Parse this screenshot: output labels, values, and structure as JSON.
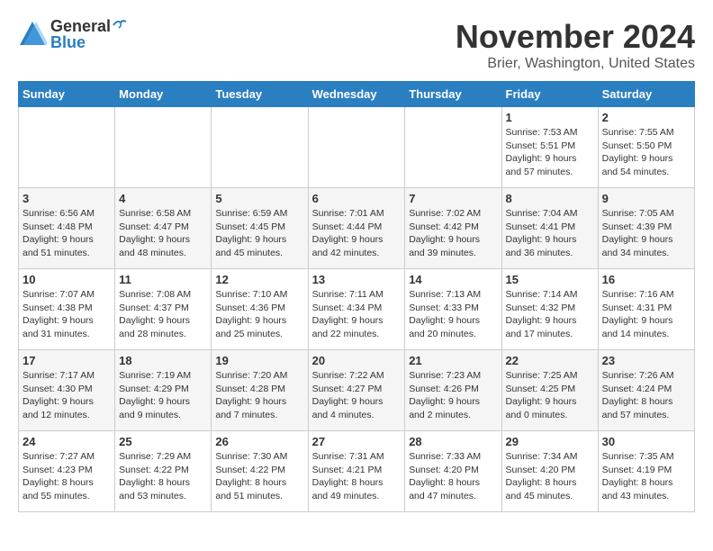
{
  "logo": {
    "general": "General",
    "blue": "Blue"
  },
  "title": "November 2024",
  "location": "Brier, Washington, United States",
  "days_of_week": [
    "Sunday",
    "Monday",
    "Tuesday",
    "Wednesday",
    "Thursday",
    "Friday",
    "Saturday"
  ],
  "weeks": [
    [
      {
        "day": "",
        "sunrise": "",
        "sunset": "",
        "daylight": ""
      },
      {
        "day": "",
        "sunrise": "",
        "sunset": "",
        "daylight": ""
      },
      {
        "day": "",
        "sunrise": "",
        "sunset": "",
        "daylight": ""
      },
      {
        "day": "",
        "sunrise": "",
        "sunset": "",
        "daylight": ""
      },
      {
        "day": "",
        "sunrise": "",
        "sunset": "",
        "daylight": ""
      },
      {
        "day": "1",
        "sunrise": "Sunrise: 7:53 AM",
        "sunset": "Sunset: 5:51 PM",
        "daylight": "Daylight: 9 hours and 57 minutes."
      },
      {
        "day": "2",
        "sunrise": "Sunrise: 7:55 AM",
        "sunset": "Sunset: 5:50 PM",
        "daylight": "Daylight: 9 hours and 54 minutes."
      }
    ],
    [
      {
        "day": "3",
        "sunrise": "Sunrise: 6:56 AM",
        "sunset": "Sunset: 4:48 PM",
        "daylight": "Daylight: 9 hours and 51 minutes."
      },
      {
        "day": "4",
        "sunrise": "Sunrise: 6:58 AM",
        "sunset": "Sunset: 4:47 PM",
        "daylight": "Daylight: 9 hours and 48 minutes."
      },
      {
        "day": "5",
        "sunrise": "Sunrise: 6:59 AM",
        "sunset": "Sunset: 4:45 PM",
        "daylight": "Daylight: 9 hours and 45 minutes."
      },
      {
        "day": "6",
        "sunrise": "Sunrise: 7:01 AM",
        "sunset": "Sunset: 4:44 PM",
        "daylight": "Daylight: 9 hours and 42 minutes."
      },
      {
        "day": "7",
        "sunrise": "Sunrise: 7:02 AM",
        "sunset": "Sunset: 4:42 PM",
        "daylight": "Daylight: 9 hours and 39 minutes."
      },
      {
        "day": "8",
        "sunrise": "Sunrise: 7:04 AM",
        "sunset": "Sunset: 4:41 PM",
        "daylight": "Daylight: 9 hours and 36 minutes."
      },
      {
        "day": "9",
        "sunrise": "Sunrise: 7:05 AM",
        "sunset": "Sunset: 4:39 PM",
        "daylight": "Daylight: 9 hours and 34 minutes."
      }
    ],
    [
      {
        "day": "10",
        "sunrise": "Sunrise: 7:07 AM",
        "sunset": "Sunset: 4:38 PM",
        "daylight": "Daylight: 9 hours and 31 minutes."
      },
      {
        "day": "11",
        "sunrise": "Sunrise: 7:08 AM",
        "sunset": "Sunset: 4:37 PM",
        "daylight": "Daylight: 9 hours and 28 minutes."
      },
      {
        "day": "12",
        "sunrise": "Sunrise: 7:10 AM",
        "sunset": "Sunset: 4:36 PM",
        "daylight": "Daylight: 9 hours and 25 minutes."
      },
      {
        "day": "13",
        "sunrise": "Sunrise: 7:11 AM",
        "sunset": "Sunset: 4:34 PM",
        "daylight": "Daylight: 9 hours and 22 minutes."
      },
      {
        "day": "14",
        "sunrise": "Sunrise: 7:13 AM",
        "sunset": "Sunset: 4:33 PM",
        "daylight": "Daylight: 9 hours and 20 minutes."
      },
      {
        "day": "15",
        "sunrise": "Sunrise: 7:14 AM",
        "sunset": "Sunset: 4:32 PM",
        "daylight": "Daylight: 9 hours and 17 minutes."
      },
      {
        "day": "16",
        "sunrise": "Sunrise: 7:16 AM",
        "sunset": "Sunset: 4:31 PM",
        "daylight": "Daylight: 9 hours and 14 minutes."
      }
    ],
    [
      {
        "day": "17",
        "sunrise": "Sunrise: 7:17 AM",
        "sunset": "Sunset: 4:30 PM",
        "daylight": "Daylight: 9 hours and 12 minutes."
      },
      {
        "day": "18",
        "sunrise": "Sunrise: 7:19 AM",
        "sunset": "Sunset: 4:29 PM",
        "daylight": "Daylight: 9 hours and 9 minutes."
      },
      {
        "day": "19",
        "sunrise": "Sunrise: 7:20 AM",
        "sunset": "Sunset: 4:28 PM",
        "daylight": "Daylight: 9 hours and 7 minutes."
      },
      {
        "day": "20",
        "sunrise": "Sunrise: 7:22 AM",
        "sunset": "Sunset: 4:27 PM",
        "daylight": "Daylight: 9 hours and 4 minutes."
      },
      {
        "day": "21",
        "sunrise": "Sunrise: 7:23 AM",
        "sunset": "Sunset: 4:26 PM",
        "daylight": "Daylight: 9 hours and 2 minutes."
      },
      {
        "day": "22",
        "sunrise": "Sunrise: 7:25 AM",
        "sunset": "Sunset: 4:25 PM",
        "daylight": "Daylight: 9 hours and 0 minutes."
      },
      {
        "day": "23",
        "sunrise": "Sunrise: 7:26 AM",
        "sunset": "Sunset: 4:24 PM",
        "daylight": "Daylight: 8 hours and 57 minutes."
      }
    ],
    [
      {
        "day": "24",
        "sunrise": "Sunrise: 7:27 AM",
        "sunset": "Sunset: 4:23 PM",
        "daylight": "Daylight: 8 hours and 55 minutes."
      },
      {
        "day": "25",
        "sunrise": "Sunrise: 7:29 AM",
        "sunset": "Sunset: 4:22 PM",
        "daylight": "Daylight: 8 hours and 53 minutes."
      },
      {
        "day": "26",
        "sunrise": "Sunrise: 7:30 AM",
        "sunset": "Sunset: 4:22 PM",
        "daylight": "Daylight: 8 hours and 51 minutes."
      },
      {
        "day": "27",
        "sunrise": "Sunrise: 7:31 AM",
        "sunset": "Sunset: 4:21 PM",
        "daylight": "Daylight: 8 hours and 49 minutes."
      },
      {
        "day": "28",
        "sunrise": "Sunrise: 7:33 AM",
        "sunset": "Sunset: 4:20 PM",
        "daylight": "Daylight: 8 hours and 47 minutes."
      },
      {
        "day": "29",
        "sunrise": "Sunrise: 7:34 AM",
        "sunset": "Sunset: 4:20 PM",
        "daylight": "Daylight: 8 hours and 45 minutes."
      },
      {
        "day": "30",
        "sunrise": "Sunrise: 7:35 AM",
        "sunset": "Sunset: 4:19 PM",
        "daylight": "Daylight: 8 hours and 43 minutes."
      }
    ]
  ]
}
